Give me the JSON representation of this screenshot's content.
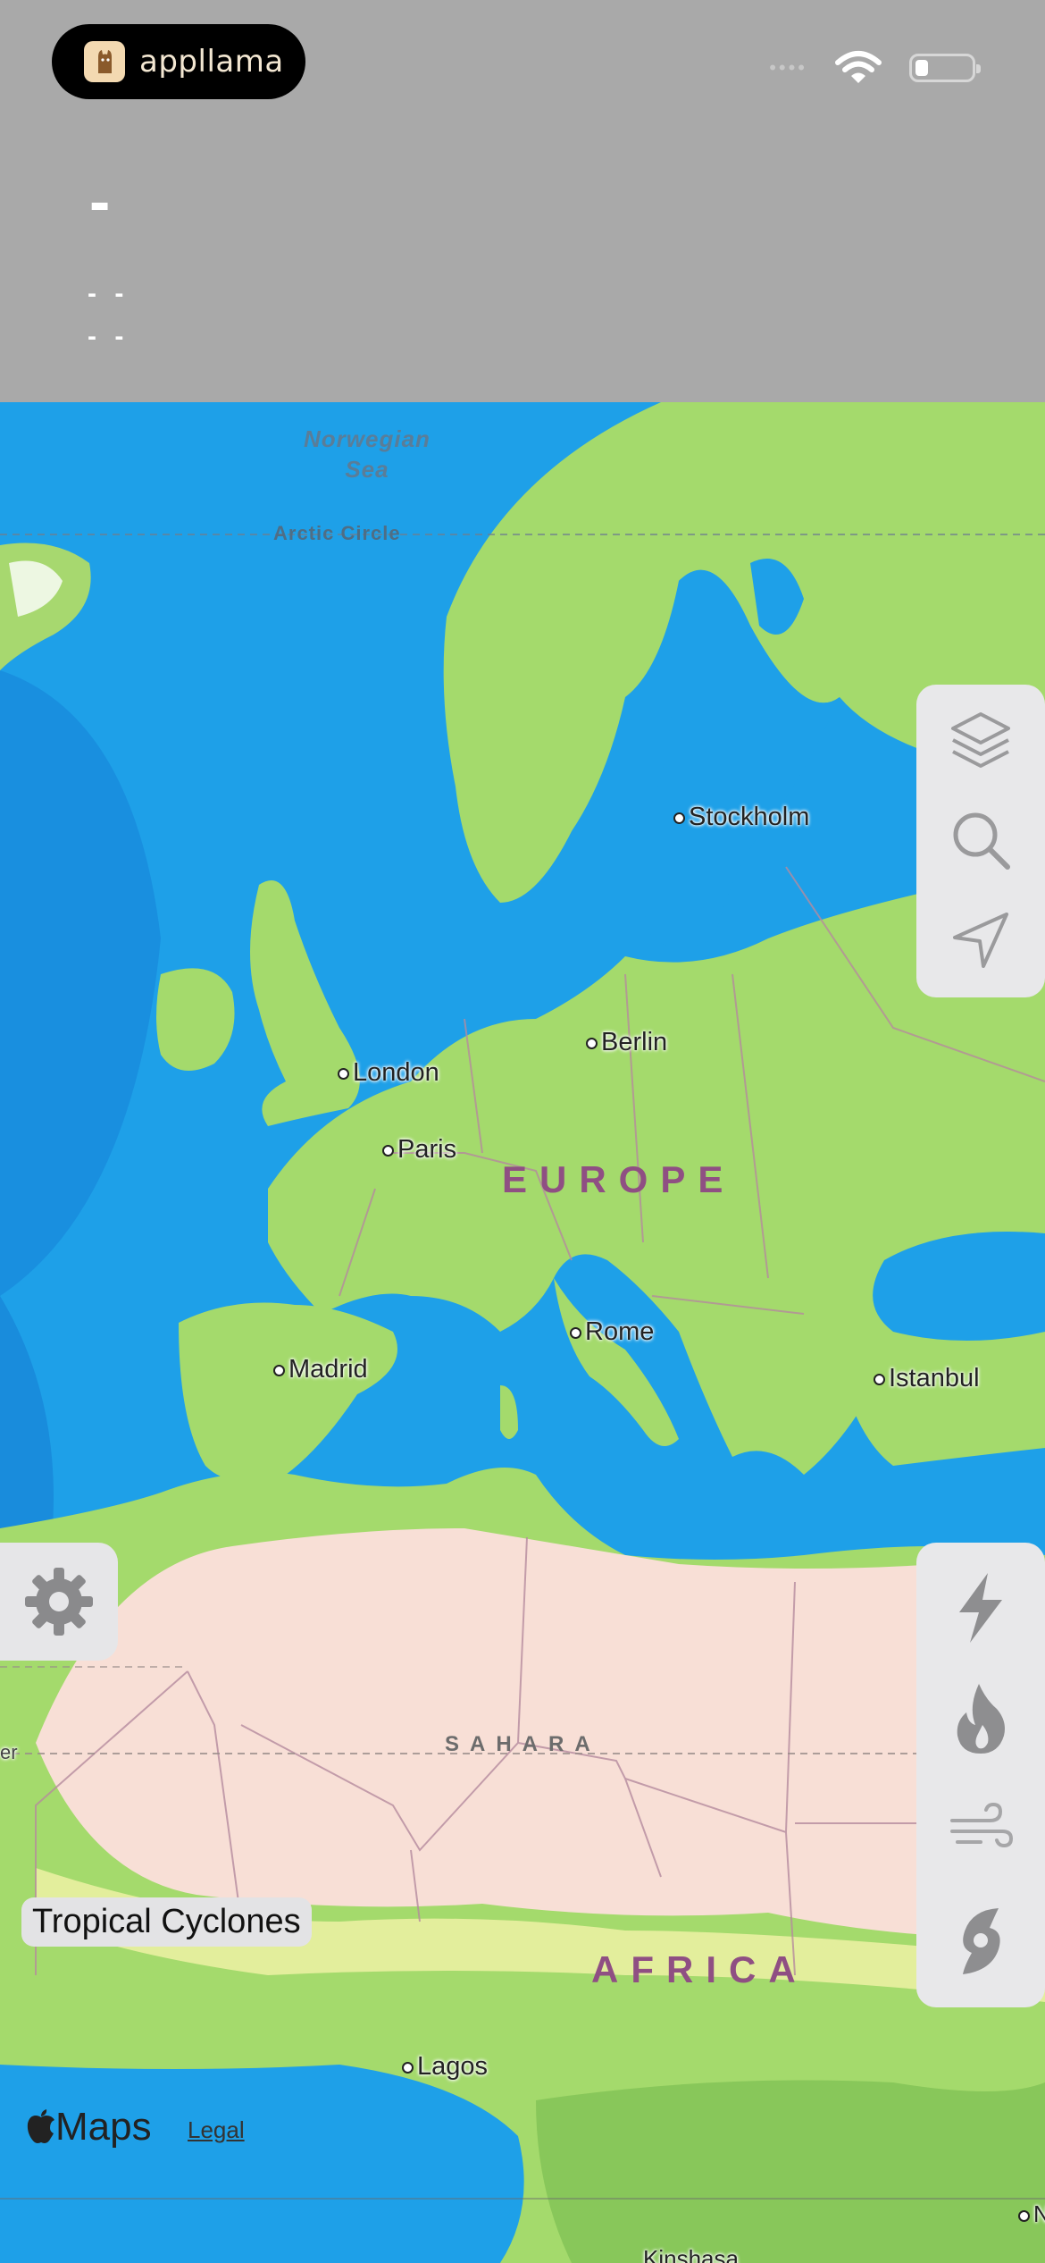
{
  "header": {
    "brand": {
      "name": "appllama",
      "logo_icon": "llama-icon"
    },
    "status_bar": {
      "signal_icon": "signal-dots-icon",
      "wifi_icon": "wifi-icon",
      "battery_icon": "battery-icon"
    },
    "title_placeholder": "-",
    "line1": "- -",
    "line2": "- -"
  },
  "map": {
    "sea_labels": [
      {
        "text": "Norwegian\nSea"
      }
    ],
    "arctic_circle": "Arctic Circle",
    "cities": [
      "Stockholm",
      "Berlin",
      "London",
      "Paris",
      "Rome",
      "Madrid",
      "Istanbul",
      "Lagos"
    ],
    "regions": {
      "europe": "EUROPE",
      "africa": "AFRICA",
      "sahara": "SAHARA"
    },
    "edge_labels": {
      "left": "er",
      "bottom_right": "N",
      "bottom": "Kinshasa"
    },
    "colors": {
      "water": "#1ea0e8",
      "deep_water": "#1280d6",
      "land": "#a4da6c",
      "desert": "#f8dfd6",
      "border": "#b58b9e"
    }
  },
  "controls": {
    "top_panel": [
      {
        "icon": "layers-icon"
      },
      {
        "icon": "search-icon"
      },
      {
        "icon": "location-arrow-icon"
      }
    ],
    "bottom_panel": [
      {
        "icon": "lightning-icon"
      },
      {
        "icon": "fire-icon"
      },
      {
        "icon": "wind-icon"
      },
      {
        "icon": "hurricane-icon"
      }
    ],
    "settings_icon": "gear-icon"
  },
  "overlay": {
    "layer_label": "Tropical Cyclones"
  },
  "attribution": {
    "maps": "Maps",
    "legal": "Legal"
  }
}
